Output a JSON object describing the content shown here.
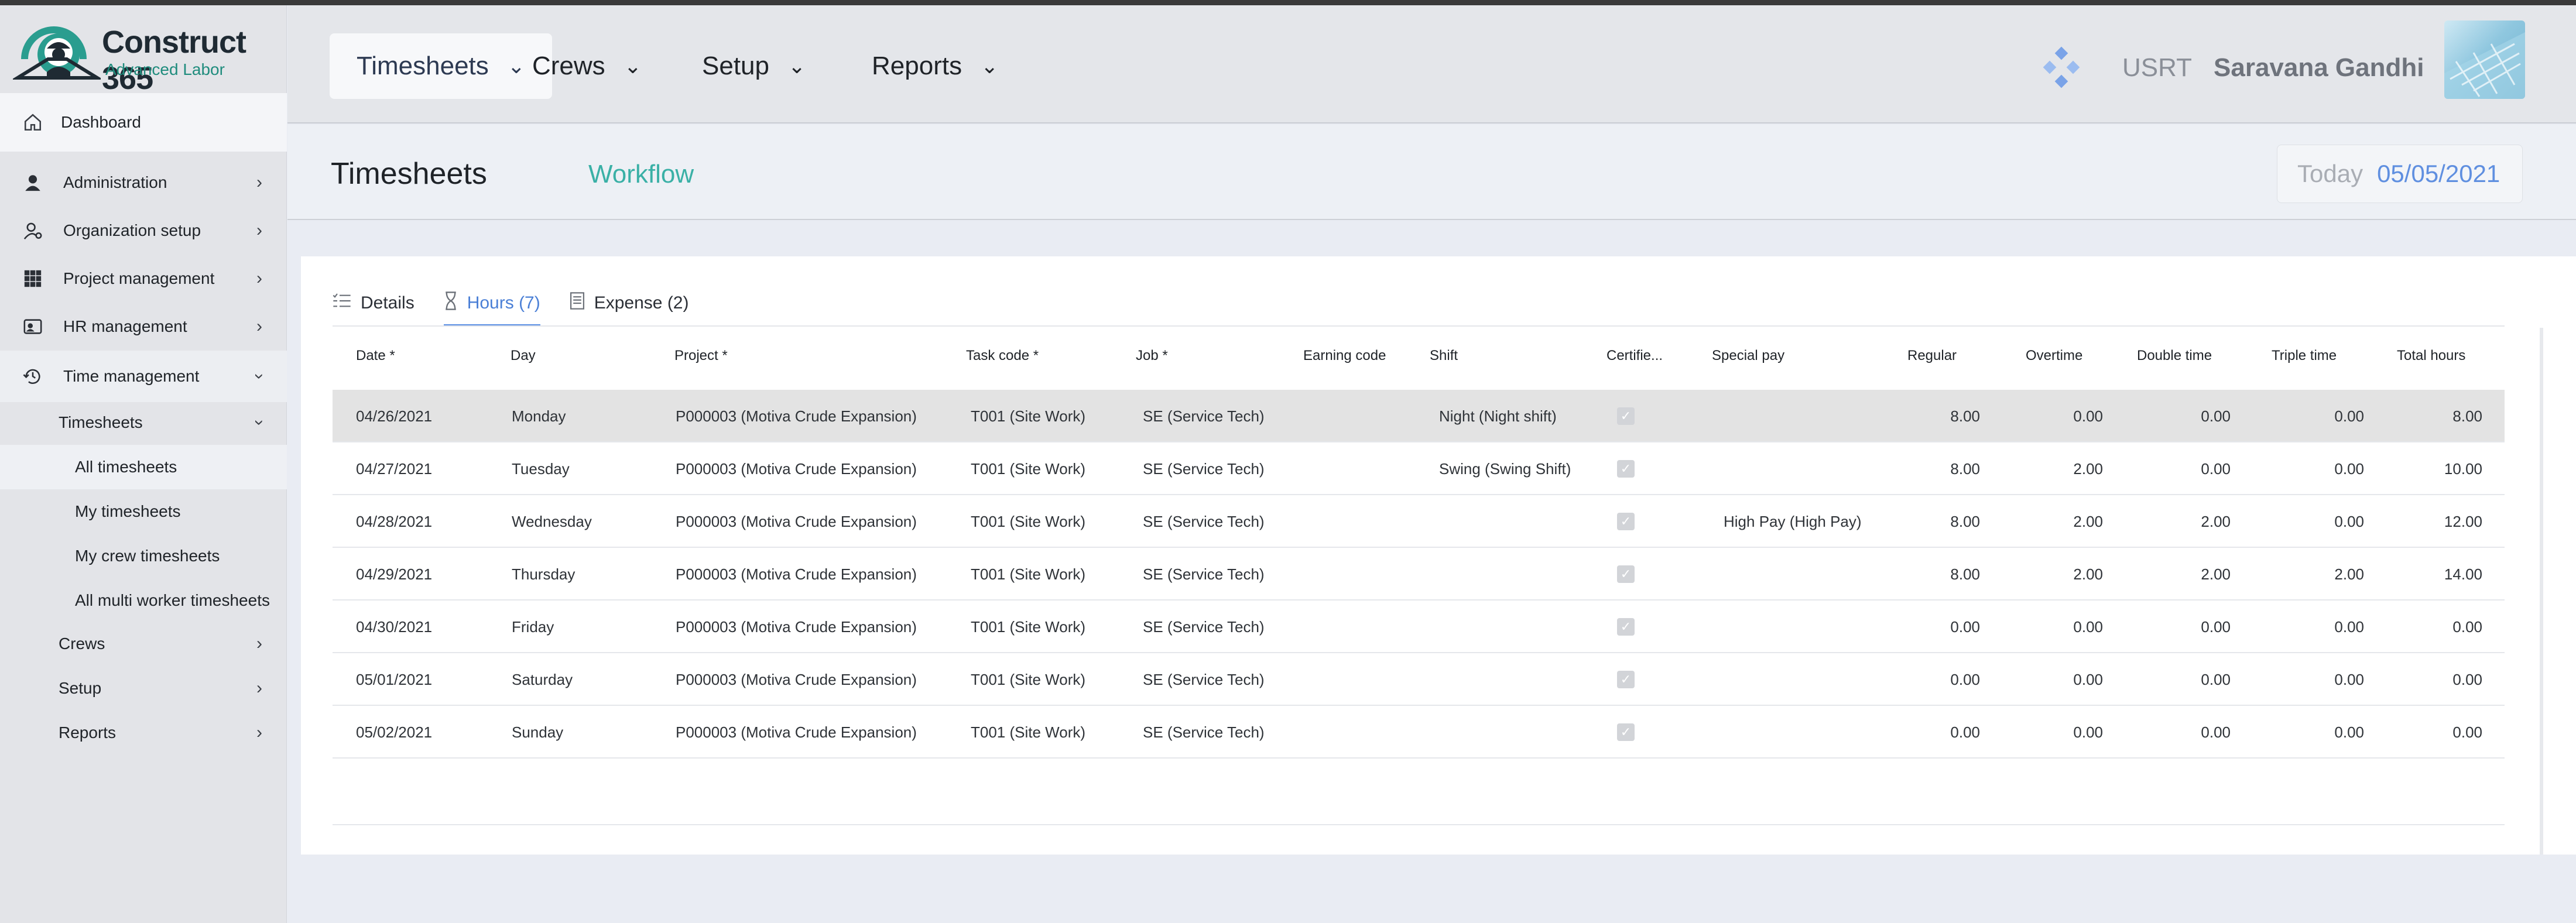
{
  "app": {
    "logo_title": "Construct 365",
    "logo_subtitle": "Advanced Labor",
    "brand_color": "#1f8c7d",
    "accent_color": "#5a8fe4"
  },
  "sidebar": {
    "dashboard": {
      "label": "Dashboard",
      "icon": "home-icon"
    },
    "items": [
      {
        "label": "Administration",
        "icon": "person-icon"
      },
      {
        "label": "Organization setup",
        "icon": "person-gear-icon"
      },
      {
        "label": "Project management",
        "icon": "grid-icon"
      },
      {
        "label": "HR management",
        "icon": "id-card-icon"
      },
      {
        "label": "Time management",
        "icon": "history-icon"
      }
    ],
    "time_sub": {
      "timesheets": "Timesheets",
      "children": [
        "All timesheets",
        "My timesheets",
        "My crew timesheets",
        "All multi worker timesheets"
      ],
      "crews": "Crews",
      "setup": "Setup",
      "reports": "Reports"
    }
  },
  "header": {
    "menus": [
      "Timesheets",
      "Crews",
      "Setup",
      "Reports"
    ],
    "tenant": "USRT",
    "user_name": "Saravana Gandhi"
  },
  "page": {
    "title": "Timesheets",
    "workflow": "Workflow",
    "today_label": "Today",
    "today_date": "05/05/2021"
  },
  "tabs": [
    {
      "label": "Details",
      "icon": "list-icon"
    },
    {
      "label": "Hours (7)",
      "icon": "hourglass-icon"
    },
    {
      "label": "Expense (2)",
      "icon": "receipt-icon"
    }
  ],
  "table": {
    "columns": [
      "Date *",
      "Day",
      "Project *",
      "Task code *",
      "Job *",
      "Earning code",
      "Shift",
      "Certifie...",
      "Special pay",
      "Regular",
      "Overtime",
      "Double time",
      "Triple time",
      "Total hours"
    ],
    "rows": [
      {
        "date": "04/26/2021",
        "day": "Monday",
        "project": "P000003 (Motiva Crude Expansion)",
        "task": "T001 (Site Work)",
        "job": "SE (Service Tech)",
        "earning": "",
        "shift": "Night (Night shift)",
        "special": "",
        "regular": "8.00",
        "overtime": "0.00",
        "double": "0.00",
        "triple": "0.00",
        "total": "8.00"
      },
      {
        "date": "04/27/2021",
        "day": "Tuesday",
        "project": "P000003 (Motiva Crude Expansion)",
        "task": "T001 (Site Work)",
        "job": "SE (Service Tech)",
        "earning": "",
        "shift": "Swing (Swing Shift)",
        "special": "",
        "regular": "8.00",
        "overtime": "2.00",
        "double": "0.00",
        "triple": "0.00",
        "total": "10.00"
      },
      {
        "date": "04/28/2021",
        "day": "Wednesday",
        "project": "P000003 (Motiva Crude Expansion)",
        "task": "T001 (Site Work)",
        "job": "SE (Service Tech)",
        "earning": "",
        "shift": "",
        "special": "High Pay (High Pay)",
        "regular": "8.00",
        "overtime": "2.00",
        "double": "2.00",
        "triple": "0.00",
        "total": "12.00"
      },
      {
        "date": "04/29/2021",
        "day": "Thursday",
        "project": "P000003 (Motiva Crude Expansion)",
        "task": "T001 (Site Work)",
        "job": "SE (Service Tech)",
        "earning": "",
        "shift": "",
        "special": "",
        "regular": "8.00",
        "overtime": "2.00",
        "double": "2.00",
        "triple": "2.00",
        "total": "14.00"
      },
      {
        "date": "04/30/2021",
        "day": "Friday",
        "project": "P000003 (Motiva Crude Expansion)",
        "task": "T001 (Site Work)",
        "job": "SE (Service Tech)",
        "earning": "",
        "shift": "",
        "special": "",
        "regular": "0.00",
        "overtime": "0.00",
        "double": "0.00",
        "triple": "0.00",
        "total": "0.00"
      },
      {
        "date": "05/01/2021",
        "day": "Saturday",
        "project": "P000003 (Motiva Crude Expansion)",
        "task": "T001 (Site Work)",
        "job": "SE (Service Tech)",
        "earning": "",
        "shift": "",
        "special": "",
        "regular": "0.00",
        "overtime": "0.00",
        "double": "0.00",
        "triple": "0.00",
        "total": "0.00"
      },
      {
        "date": "05/02/2021",
        "day": "Sunday",
        "project": "P000003 (Motiva Crude Expansion)",
        "task": "T001 (Site Work)",
        "job": "SE (Service Tech)",
        "earning": "",
        "shift": "",
        "special": "",
        "regular": "0.00",
        "overtime": "0.00",
        "double": "0.00",
        "triple": "0.00",
        "total": "0.00"
      }
    ]
  }
}
